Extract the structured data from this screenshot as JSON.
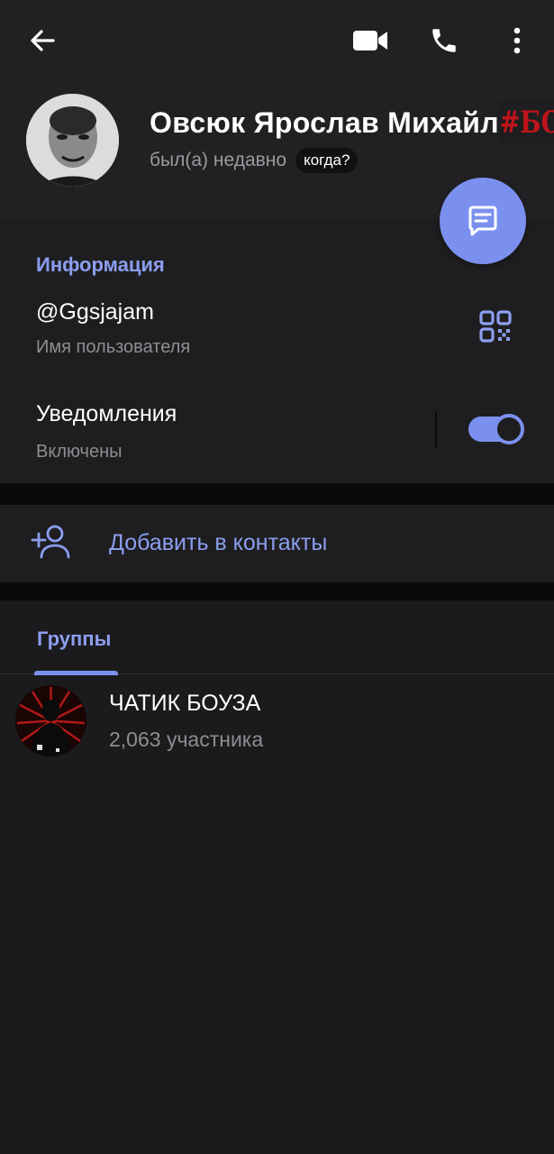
{
  "colors": {
    "accent": "#7b90ee",
    "accent_text": "#8c9ef0",
    "background": "#1b1b1d",
    "header_background": "#212123",
    "badge_red": "#c0141a"
  },
  "toolbar": {
    "back_icon": "arrow-left-icon",
    "video_icon": "video-camera-icon",
    "call_icon": "phone-icon",
    "menu_icon": "more-vertical-icon"
  },
  "profile": {
    "name": "Овсюк Ярослав Михайлович",
    "badge": "#БОГ",
    "status": "был(а) недавно",
    "when_chip": "когда?",
    "message_button_icon": "message-icon"
  },
  "info": {
    "title": "Информация",
    "username": "@Ggsjajam",
    "username_caption": "Имя пользователя",
    "qr_icon": "qr-code-icon",
    "notifications_label": "Уведомления",
    "notifications_state": "Включены",
    "notifications_enabled": true
  },
  "add_contact": {
    "icon": "add-user-icon",
    "label": "Добавить в контакты"
  },
  "groups": {
    "tab_label": "Группы",
    "items": [
      {
        "name": "ЧАТИК БОУЗА",
        "members": "2,063 участника"
      }
    ]
  }
}
